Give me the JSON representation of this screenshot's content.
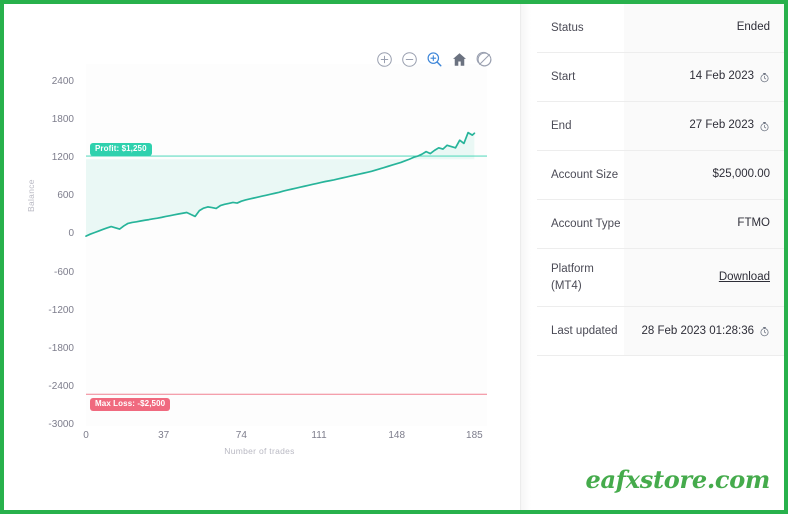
{
  "chart_data": {
    "type": "line",
    "title": "",
    "xlabel": "Number of trades",
    "ylabel": "Balance",
    "xlim": [
      0,
      191
    ],
    "ylim": [
      -3000,
      2700
    ],
    "xticks": [
      "0",
      "37",
      "74",
      "111",
      "148",
      "185"
    ],
    "xtick_values": [
      0,
      37,
      74,
      111,
      148,
      185
    ],
    "yticks": [
      "2400",
      "1800",
      "1200",
      "600",
      "0",
      "-600",
      "-1200",
      "-1800",
      "-2400",
      "-3000"
    ],
    "ytick_values": [
      2400,
      1800,
      1200,
      600,
      0,
      -600,
      -1200,
      -1800,
      -2400,
      -3000
    ],
    "grid": false,
    "legend": "none",
    "series": [
      {
        "name": "Balance",
        "color": "#27b49a",
        "fill_color": "#e6f7f3",
        "x": [
          0,
          2,
          4,
          6,
          8,
          10,
          12,
          14,
          16,
          18,
          20,
          22,
          24,
          26,
          28,
          30,
          32,
          34,
          36,
          38,
          40,
          42,
          44,
          46,
          48,
          50,
          52,
          54,
          56,
          58,
          60,
          62,
          64,
          66,
          68,
          70,
          72,
          74,
          76,
          78,
          80,
          82,
          84,
          86,
          88,
          90,
          92,
          94,
          96,
          98,
          100,
          102,
          104,
          106,
          108,
          110,
          112,
          114,
          116,
          118,
          120,
          122,
          124,
          126,
          128,
          130,
          132,
          134,
          136,
          138,
          140,
          142,
          144,
          146,
          148,
          150,
          152,
          154,
          156,
          158,
          160,
          162,
          164,
          166,
          168,
          170,
          172,
          174,
          176,
          178,
          180,
          182,
          184,
          185
        ],
        "y": [
          -10,
          20,
          45,
          70,
          95,
          118,
          140,
          120,
          100,
          150,
          190,
          205,
          215,
          228,
          240,
          250,
          262,
          272,
          285,
          300,
          312,
          325,
          338,
          350,
          362,
          330,
          300,
          392,
          430,
          450,
          440,
          425,
          470,
          490,
          505,
          520,
          510,
          540,
          560,
          575,
          590,
          605,
          620,
          635,
          650,
          665,
          680,
          700,
          715,
          730,
          745,
          760,
          775,
          790,
          805,
          820,
          835,
          850,
          862,
          875,
          890,
          905,
          920,
          935,
          950,
          965,
          980,
          995,
          1010,
          1030,
          1050,
          1070,
          1090,
          1110,
          1130,
          1150,
          1175,
          1200,
          1230,
          1250,
          1280,
          1320,
          1290,
          1340,
          1380,
          1360,
          1420,
          1400,
          1380,
          1500,
          1450,
          1620,
          1580,
          1610
        ]
      }
    ],
    "reference_lines": [
      {
        "name": "profit-target",
        "value": 1250,
        "label": "Profit: $1,250",
        "color": "#2fd1ae"
      },
      {
        "name": "max-loss",
        "value": -2500,
        "label": "Max Loss: -$2,500",
        "color": "#f06a7f"
      }
    ],
    "toolbar": [
      {
        "name": "zoom-in-icon",
        "label": "Zoom In",
        "active": false
      },
      {
        "name": "zoom-out-icon",
        "label": "Zoom Out",
        "active": false
      },
      {
        "name": "selection-zoom-icon",
        "label": "Selection Zoom",
        "active": true
      },
      {
        "name": "home-icon",
        "label": "Reset Zoom",
        "active": false
      },
      {
        "name": "menu-off-icon",
        "label": "Hide Menu",
        "active": false
      }
    ]
  },
  "info_panel": {
    "rows": [
      {
        "key": "Status",
        "value": "Ended",
        "icon": "",
        "link": false
      },
      {
        "key": "Start",
        "value": "14 Feb 2023",
        "icon": "clock",
        "link": false
      },
      {
        "key": "End",
        "value": "27 Feb 2023",
        "icon": "clock",
        "link": false
      },
      {
        "key": "Account Size",
        "value": "$25,000.00",
        "icon": "",
        "link": false
      },
      {
        "key": "Account Type",
        "value": "FTMO",
        "icon": "",
        "link": false
      },
      {
        "key": "Platform (MT4)",
        "value": "Download",
        "icon": "",
        "link": true
      },
      {
        "key": "Last updated",
        "value": "28 Feb 2023 01:28:36",
        "icon": "clock",
        "link": false
      }
    ]
  },
  "watermark": {
    "text": "eafxstore.com"
  },
  "colors": {
    "border": "#28b14c",
    "profit": "#2fd1ae",
    "loss": "#f06a7f",
    "line": "#27b49a",
    "area": "#e6f7f3",
    "watermark": "#45ab4c"
  }
}
